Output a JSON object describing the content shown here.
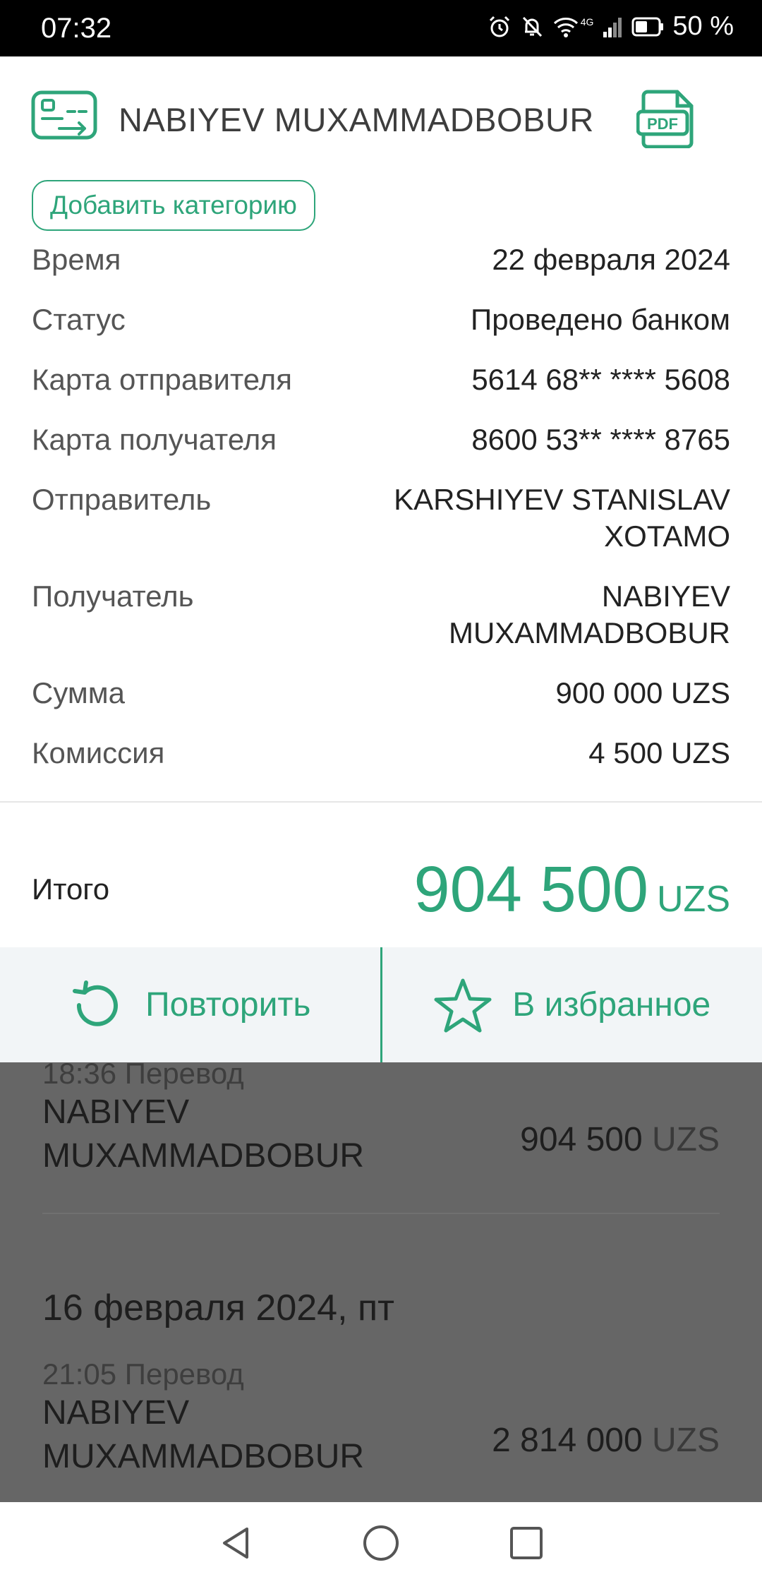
{
  "status_bar": {
    "time": "07:32",
    "network": "4G",
    "battery": "50 %"
  },
  "sheet": {
    "title": "NABIYEV MUXAMMADBOBUR",
    "pdf_label": "PDF",
    "add_category": "Добавить категорию",
    "details": [
      {
        "label": "Время",
        "value": "22 февраля 2024"
      },
      {
        "label": "Статус",
        "value": "Проведено банком"
      },
      {
        "label": "Карта отправителя",
        "value": "5614 68** **** 5608"
      },
      {
        "label": "Карта получателя",
        "value": "8600 53** **** 8765"
      },
      {
        "label": "Отправитель",
        "value": "KARSHIYEV STANISLAV XOTAMO"
      },
      {
        "label": "Получатель",
        "value": "NABIYEV MUXAMMADBOBUR"
      },
      {
        "label": "Сумма",
        "value": "900 000 UZS"
      },
      {
        "label": "Комиссия",
        "value": "4 500 UZS"
      }
    ],
    "total": {
      "label": "Итого",
      "amount": "904 500",
      "currency": "UZS"
    },
    "actions": {
      "repeat": "Повторить",
      "favorite": "В избранное"
    }
  },
  "background_list": {
    "items": [
      {
        "meta": "18:36 Перевод",
        "name_line1": "NABIYEV",
        "name_line2": "MUXAMMADBOBUR",
        "amount": "904 500",
        "currency": "UZS"
      },
      {
        "meta": "21:05 Перевод",
        "name_line1": "NABIYEV",
        "name_line2": "MUXAMMADBOBUR",
        "amount": "2 814 000",
        "currency": "UZS"
      }
    ],
    "date_header": "16 февраля 2024, пт"
  },
  "colors": {
    "accent": "#2ea57a",
    "dim": "#666666"
  },
  "icons": [
    "alarm-icon",
    "bell-off-icon",
    "wifi-icon",
    "signal-icon",
    "battery-icon",
    "transfer-icon",
    "pdf-icon",
    "repeat-icon",
    "star-icon",
    "back-icon",
    "home-icon",
    "recents-icon"
  ]
}
